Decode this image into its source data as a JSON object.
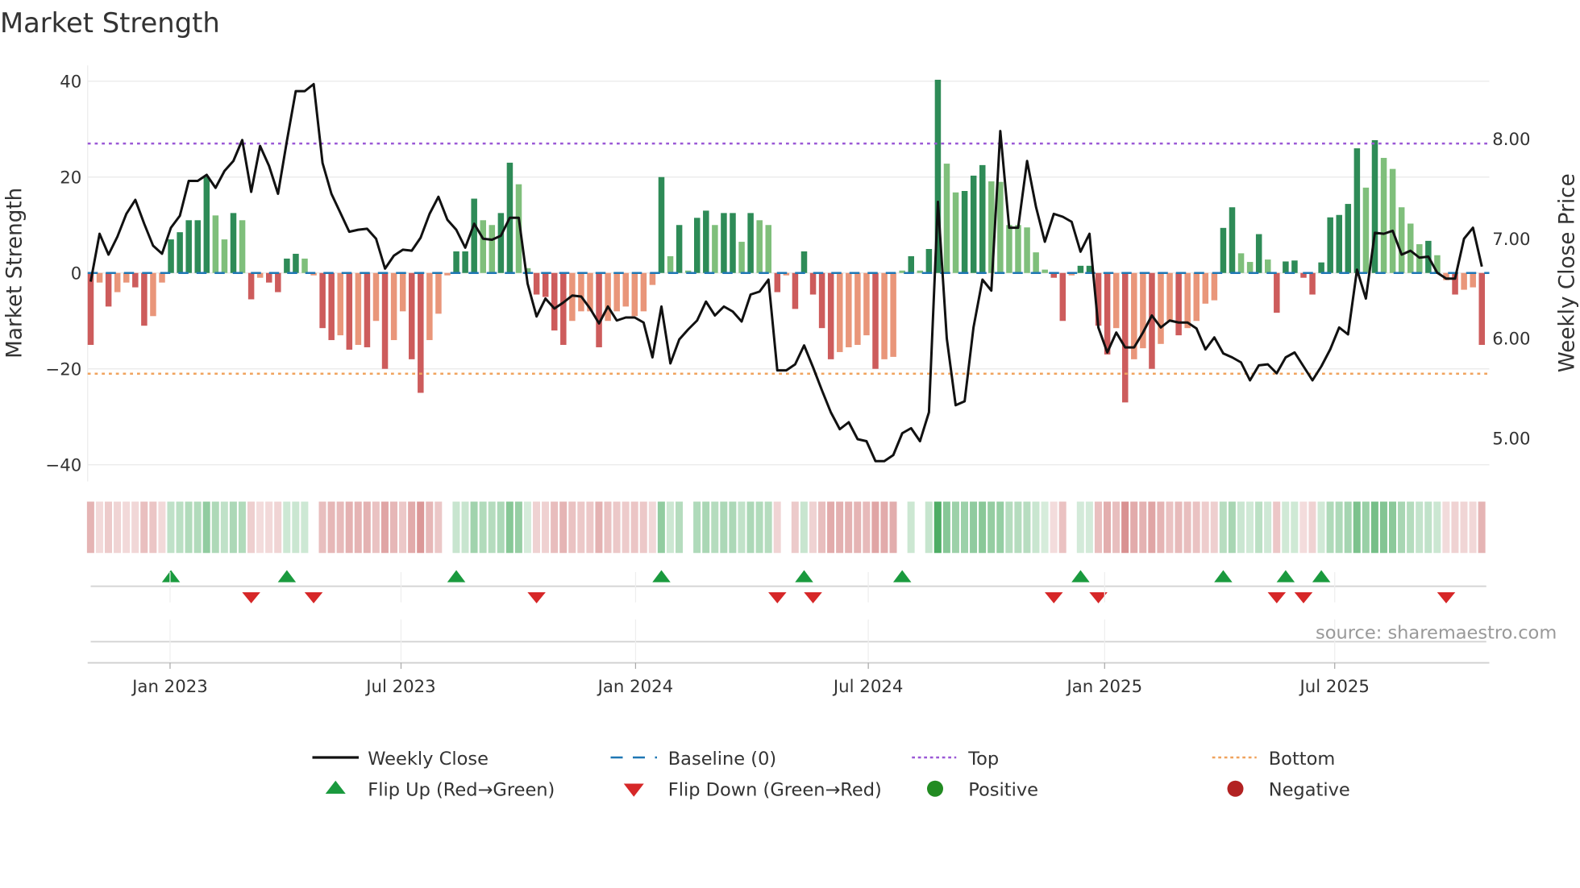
{
  "chart_data": {
    "type": "bar",
    "title": "Market Strength",
    "ylabel": "Market Strength",
    "y2label": "Weekly Close Price",
    "ylim": [
      -43,
      43
    ],
    "y_ticks": [
      40,
      20,
      0,
      -20,
      -40
    ],
    "y_tick_labels": [
      "40",
      "20",
      "0",
      "−20",
      "−40"
    ],
    "y2_ticks": [
      8,
      7,
      6,
      5
    ],
    "y2_tick_labels": [
      "8.00",
      "7.00",
      "6.00",
      "5.00"
    ],
    "x_ticks": [
      {
        "label": "Jan 2023",
        "week": 8.9
      },
      {
        "label": "Jul 2023",
        "week": 34.8
      },
      {
        "label": "Jan 2024",
        "week": 61.1
      },
      {
        "label": "Jul 2024",
        "week": 87.2
      },
      {
        "label": "Jan 2025",
        "week": 113.7
      },
      {
        "label": "Jul 2025",
        "week": 139.5
      }
    ],
    "top_level": 27,
    "bottom_level": -21,
    "baseline": 0,
    "strength": [
      -15,
      -2,
      -7,
      -4,
      -2,
      -3,
      -11,
      -9,
      -2,
      7,
      8.5,
      11,
      11,
      20,
      12,
      7,
      12.5,
      11,
      -5.5,
      -1,
      -2,
      -4,
      3,
      4,
      3,
      -0.5,
      -11.5,
      -14,
      -13,
      -16,
      -15,
      -15.5,
      -10,
      -20,
      -14,
      -8,
      -18,
      -25,
      -14,
      -8.5,
      -0.5,
      4.5,
      4.5,
      15.5,
      11,
      10,
      12.5,
      23,
      18.5,
      1,
      -4.5,
      -5,
      -12,
      -15,
      -10,
      -8,
      -8,
      -15.5,
      -10,
      -8,
      -7,
      -9,
      -8,
      -2.5,
      20,
      3.5,
      10,
      0.5,
      11.5,
      13,
      10,
      12.5,
      12.5,
      6.5,
      12.5,
      11,
      10,
      -4,
      -0.5,
      -7.5,
      4.5,
      -4.5,
      -11.5,
      -18,
      -16.5,
      -15.5,
      -15,
      -13,
      -20,
      -18,
      -17.5,
      0.5,
      3.5,
      0.5,
      5,
      40.3,
      22.8,
      16.8,
      17.1,
      20.3,
      22.5,
      19.1,
      19,
      10,
      10,
      9.5,
      4.3,
      0.7,
      -1,
      -10,
      -0.5,
      1.5,
      1.5,
      -11,
      -17,
      -11.5,
      -27,
      -18,
      -15.7,
      -20,
      -14.8,
      -10,
      -13,
      -11.5,
      -10,
      -6.4,
      -5.7,
      9.4,
      13.7,
      4.1,
      2.3,
      8.1,
      2.8,
      -8.3,
      2.4,
      2.6,
      -1,
      -4.5,
      2.2,
      11.6,
      12.1,
      14.4,
      26,
      17.8,
      27.7,
      24,
      21.7,
      13.7,
      10.3,
      6,
      6.7,
      3.7,
      -1.5,
      -4.5,
      -3.5,
      -3,
      -15
    ],
    "shade": "DLDLLDDLLDDDDDLLDLDLDDDDLLDDLDLDLDLLDDLLLDDDLLDDLLDDDDLLLDLLLLLLDLDLDDLDDLDLLDLDDDDDLLLLDLLLDLDDLLDDDLLLLLLLDDLDDDDLDLLDLLDLLLLDDLLDLDDDDDDDDDDLDLLLLLDLLDLLD",
    "weekly_close": [
      6.57,
      7.05,
      6.84,
      7.02,
      7.25,
      7.39,
      7.15,
      6.93,
      6.85,
      7.11,
      7.23,
      7.58,
      7.58,
      7.64,
      7.51,
      7.68,
      7.78,
      7.99,
      7.47,
      7.93,
      7.73,
      7.45,
      7.98,
      8.48,
      8.48,
      8.55,
      7.76,
      7.45,
      7.26,
      7.07,
      7.09,
      7.1,
      7.0,
      6.7,
      6.83,
      6.89,
      6.88,
      7.01,
      7.25,
      7.42,
      7.19,
      7.09,
      6.91,
      7.15,
      7.0,
      6.99,
      7.03,
      7.21,
      7.21,
      6.55,
      6.22,
      6.4,
      6.3,
      6.36,
      6.43,
      6.42,
      6.3,
      6.15,
      6.32,
      6.18,
      6.21,
      6.21,
      6.16,
      5.81,
      6.32,
      5.75,
      5.99,
      6.09,
      6.18,
      6.37,
      6.23,
      6.32,
      6.27,
      6.17,
      6.44,
      6.47,
      6.59,
      5.68,
      5.68,
      5.74,
      5.93,
      5.71,
      5.48,
      5.26,
      5.09,
      5.16,
      4.99,
      4.97,
      4.77,
      4.77,
      4.83,
      5.05,
      5.1,
      4.97,
      5.26,
      7.37,
      6.0,
      5.33,
      5.37,
      6.11,
      6.59,
      6.48,
      8.08,
      7.11,
      7.11,
      7.78,
      7.32,
      6.97,
      7.25,
      7.22,
      7.17,
      6.87,
      7.05,
      6.11,
      5.86,
      6.06,
      5.91,
      5.91,
      6.06,
      6.23,
      6.11,
      6.18,
      6.16,
      6.16,
      6.1,
      5.89,
      6.01,
      5.85,
      5.81,
      5.76,
      5.58,
      5.73,
      5.74,
      5.65,
      5.81,
      5.86,
      5.72,
      5.58,
      5.72,
      5.89,
      6.11,
      6.04,
      6.69,
      6.4,
      7.06,
      7.05,
      7.08,
      6.84,
      6.88,
      6.81,
      6.82,
      6.66,
      6.6,
      6.6,
      7.0,
      7.11,
      6.72
    ],
    "flip_up_weeks": [
      9,
      22,
      41,
      64,
      80,
      91,
      111,
      127,
      134,
      138
    ],
    "flip_down_weeks": [
      18,
      25,
      50,
      77,
      81,
      108,
      113,
      133,
      136,
      152
    ],
    "colors": {
      "pos_dark": "#2e8b57",
      "pos_light": "#7fbf7b",
      "neg_dark": "#cd5c5c",
      "neg_light": "#e9967a",
      "line": "#111111",
      "baseline": "#1f77b4",
      "top": "#9b59d6",
      "bottom": "#f0a35e",
      "flip_up": "#1a9a3e",
      "flip_down": "#d62728",
      "positive": "#228b22",
      "negative": "#b22222"
    },
    "legend": [
      {
        "label": "Weekly Close",
        "symbol": "line"
      },
      {
        "label": "Baseline (0)",
        "symbol": "dash"
      },
      {
        "label": "Top",
        "symbol": "dot-purple"
      },
      {
        "label": "Bottom",
        "symbol": "dot-orange"
      },
      {
        "label": "Flip Up (Red→Green)",
        "symbol": "tri-up"
      },
      {
        "label": "Flip Down (Green→Red)",
        "symbol": "tri-down"
      },
      {
        "label": "Positive",
        "symbol": "circle-green"
      },
      {
        "label": "Negative",
        "symbol": "circle-red"
      }
    ],
    "legend_position": "bottom-center",
    "source": "source: sharemaestro.com"
  }
}
